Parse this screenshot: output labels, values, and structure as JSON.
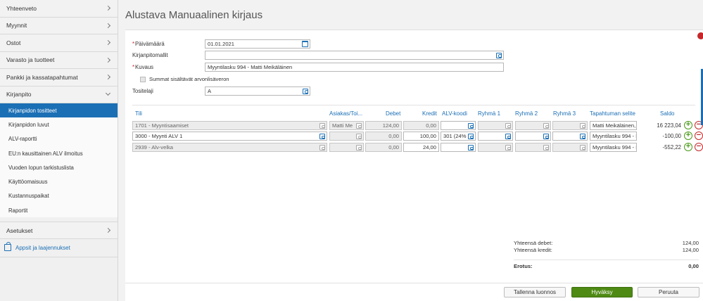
{
  "sidebar": {
    "items": [
      {
        "label": "Yhteenveto"
      },
      {
        "label": "Myynnit"
      },
      {
        "label": "Ostot"
      },
      {
        "label": "Varasto ja tuotteet"
      },
      {
        "label": "Pankki ja kassatapahtumat"
      },
      {
        "label": "Kirjanpito"
      }
    ],
    "subitems": [
      {
        "label": "Kirjanpidon tositteet"
      },
      {
        "label": "Kirjanpidon luvut"
      },
      {
        "label": "ALV-raportti"
      },
      {
        "label": "EU:n kausittainen ALV ilmoitus"
      },
      {
        "label": "Vuoden lopun tarkistuslista"
      },
      {
        "label": "Käyttöomaisuus"
      },
      {
        "label": "Kustannuspaikat"
      },
      {
        "label": "Raportit"
      }
    ],
    "settings_label": "Asetukset",
    "apps_label": "Appsit ja laajennukset"
  },
  "page": {
    "title": "Alustava Manuaalinen kirjaus"
  },
  "form": {
    "required_mark": "*",
    "date_label": "Päivämäärä",
    "date_value": "01.01.2021",
    "template_label": "Kirjanpitomallit",
    "template_value": "",
    "description_label": "Kuvaus",
    "description_value": "Myyntilasku 994 - Matti Meikäläinen",
    "vat_included_label": "Summat sisältävät arvonlisäveron",
    "doc_type_label": "Tositelaji",
    "doc_type_value": "A"
  },
  "grid": {
    "headers": {
      "account": "Tili",
      "customer": "Asiakas/Toi...",
      "debit": "Debet",
      "credit": "Kredit",
      "vat_code": "ALV-koodi",
      "group1": "Ryhmä 1",
      "group2": "Ryhmä 2",
      "group3": "Ryhmä 3",
      "event_desc": "Tapahtuman selite",
      "balance": "Saldo"
    },
    "rows": [
      {
        "account": "1701 - Myyntisaamiset",
        "customer": "Matti Me",
        "debit": "124,00",
        "credit": "0,00",
        "vat_code": "",
        "event_desc": "Matti Meikäläinen,",
        "balance": "16 223,04"
      },
      {
        "account": "3000 - Myynti ALV 1",
        "customer": "",
        "debit": "0,00",
        "credit": "100,00",
        "vat_code": "301 (24%",
        "event_desc": "Myyntilasku 994 - M",
        "balance": "-100,00"
      },
      {
        "account": "2939 - Alv-velka",
        "customer": "",
        "debit": "0,00",
        "credit": "24,00",
        "vat_code": "",
        "event_desc": "Myyntilasku 994 - M",
        "balance": "-552,22"
      }
    ]
  },
  "totals": {
    "debit_label": "Yhteensä debet:",
    "debit_value": "124,00",
    "credit_label": "Yhteensä kredit:",
    "credit_value": "124,00",
    "diff_label": "Erotus:",
    "diff_value": "0,00"
  },
  "footer": {
    "save_draft": "Tallenna luonnos",
    "approve": "Hyväksy",
    "cancel": "Peruuta"
  },
  "colors": {
    "accent": "#1b6fb5",
    "approve": "#4e8a14",
    "remove": "#c4282a"
  }
}
